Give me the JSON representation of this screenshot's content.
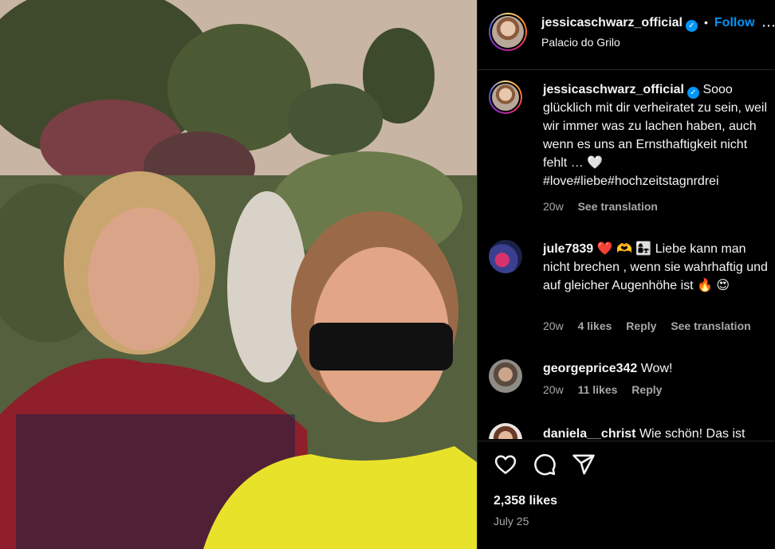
{
  "post": {
    "author": "jessicaschwarz_official",
    "location": "Palacio do Grilo",
    "follow_label": "Follow",
    "more_label": "⋯",
    "caption": "Sooo glücklich mit dir verheiratet zu sein, weil wir immer was zu lachen haben, auch wenn es uns an Ernsthaftigkeit nicht fehlt … 🤍 #love#liebe#hochzeitstagnrdrei",
    "caption_age": "20w",
    "caption_translate": "See translation",
    "likes": "2,358 likes",
    "date": "July 25"
  },
  "comments": [
    {
      "user": "jule7839",
      "text": "❤️ 🫶 👩‍👧 Liebe kann man nicht brechen , wenn sie wahrhaftig und auf gleicher Augenhöhe ist 🔥 😍",
      "age": "20w",
      "likes": "4 likes",
      "reply": "Reply",
      "translate": "See translation"
    },
    {
      "user": "georgeprice342",
      "text": "Wow!",
      "age": "20w",
      "likes": "11 likes",
      "reply": "Reply"
    },
    {
      "user": "daniela__christ",
      "text": "Wie schön! Das ist"
    }
  ],
  "icons": {
    "like": "heart-icon",
    "comment": "comment-icon",
    "share": "share-icon",
    "verified": "verified-badge-icon"
  },
  "colors": {
    "accent": "#0095f6",
    "muted": "#a8a8a8",
    "background": "#000000"
  }
}
